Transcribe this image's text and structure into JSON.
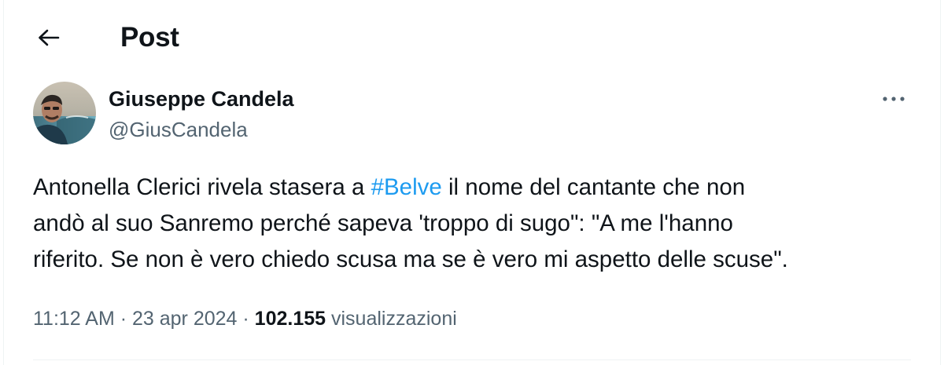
{
  "header": {
    "title": "Post",
    "back_icon": "arrow-left-icon"
  },
  "author": {
    "name": "Giuseppe Candela",
    "handle": "@GiusCandela",
    "avatar": "profile-photo"
  },
  "more_icon": "ellipsis-icon",
  "tweet": {
    "line1_before": "Antonella Clerici rivela stasera a ",
    "hashtag": "#Belve",
    "line1_after": " il nome del cantante che non",
    "line2": "andò al suo Sanremo perché sapeva 'troppo di sugo\": \"A me l'hanno",
    "line3": "riferito. Se non è vero chiedo scusa ma se è vero mi aspetto delle scuse\"."
  },
  "meta": {
    "time": "11:12 AM",
    "separator": " · ",
    "date": "23 apr 2024",
    "views_count": "102.155",
    "views_label": "visualizzazioni"
  },
  "colors": {
    "text": "#0f1419",
    "secondary": "#536471",
    "accent": "#1d9bf0",
    "divider": "#eff3f4"
  }
}
